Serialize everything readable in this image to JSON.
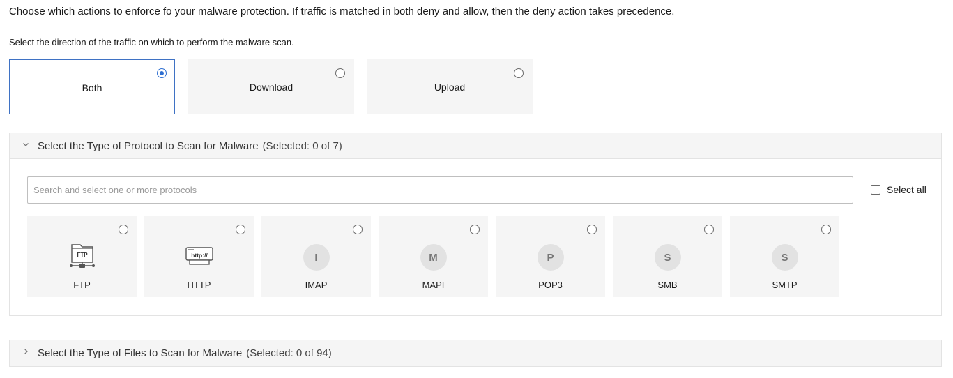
{
  "intro_text": "Choose which actions to enforce fo your malware protection. If traffic is matched in both deny and allow, then the deny action takes precedence.",
  "direction_prompt": "Select the direction of the traffic on which to perform the malware scan.",
  "directions": [
    {
      "label": "Both",
      "selected": true
    },
    {
      "label": "Download",
      "selected": false
    },
    {
      "label": "Upload",
      "selected": false
    }
  ],
  "protocol_section": {
    "title": "Select the Type of Protocol to Scan for Malware",
    "count": "(Selected: 0 of 7)",
    "expanded": true,
    "search_placeholder": "Search and select one or more protocols",
    "select_all_label": "Select all",
    "protocols": [
      {
        "name": "FTP",
        "icon": "ftp-icon",
        "letter": ""
      },
      {
        "name": "HTTP",
        "icon": "http-icon",
        "letter": ""
      },
      {
        "name": "IMAP",
        "icon": "letter-avatar",
        "letter": "I"
      },
      {
        "name": "MAPI",
        "icon": "letter-avatar",
        "letter": "M"
      },
      {
        "name": "POP3",
        "icon": "letter-avatar",
        "letter": "P"
      },
      {
        "name": "SMB",
        "icon": "letter-avatar",
        "letter": "S"
      },
      {
        "name": "SMTP",
        "icon": "letter-avatar",
        "letter": "S"
      }
    ]
  },
  "files_section": {
    "title": "Select the Type of Files to Scan for Malware",
    "count": "(Selected: 0 of 94)",
    "expanded": false
  },
  "colors": {
    "accent": "#2f6fd1",
    "card_bg": "#f5f5f5",
    "border": "#e3e3e3"
  }
}
